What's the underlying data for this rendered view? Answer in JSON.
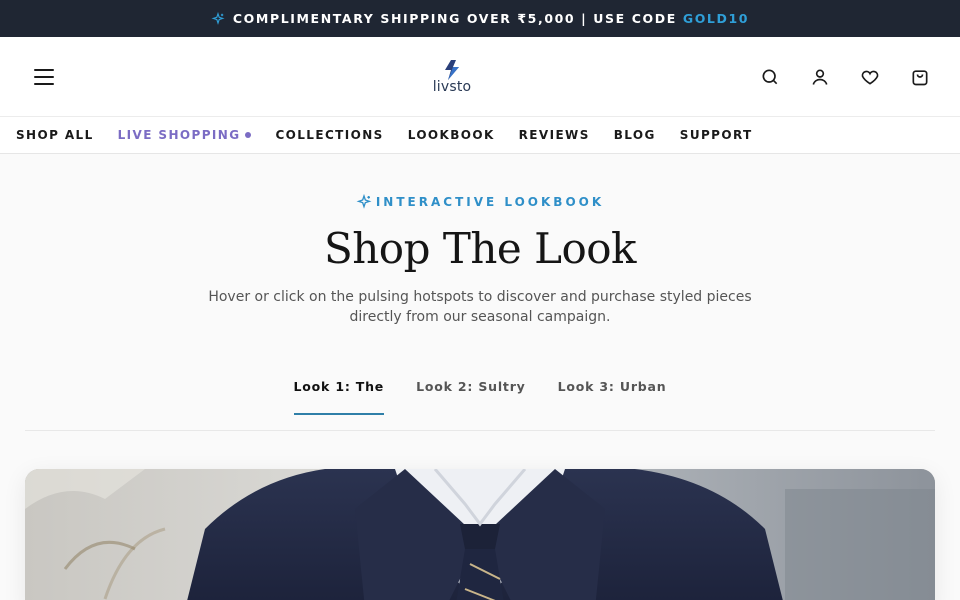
{
  "promo": {
    "text": "COMPLIMENTARY SHIPPING OVER ₹5,000 | USE CODE",
    "code": "GOLD10",
    "code_color": "#2f9fd8"
  },
  "header": {
    "logo_text": "livsto",
    "icons": [
      "menu-icon",
      "search-icon",
      "user-icon",
      "heart-icon",
      "bag-icon"
    ]
  },
  "nav": {
    "items": [
      {
        "label": "SHOP ALL"
      },
      {
        "label": "LIVE SHOPPING"
      },
      {
        "label": "COLLECTIONS"
      },
      {
        "label": "LOOKBOOK"
      },
      {
        "label": "REVIEWS"
      },
      {
        "label": "BLOG"
      },
      {
        "label": "SUPPORT"
      }
    ],
    "live_color": "#7b6cc4"
  },
  "hero": {
    "eyebrow": "INTERACTIVE LOOKBOOK",
    "title": "Shop The Look",
    "subtitle": "Hover or click on the pulsing hotspots to discover and purchase styled pieces directly from our seasonal campaign."
  },
  "tabs": [
    {
      "label": "Look 1: The",
      "active": true
    },
    {
      "label": "Look 2: Sultry",
      "active": false
    },
    {
      "label": "Look 3: Urban",
      "active": false
    }
  ]
}
